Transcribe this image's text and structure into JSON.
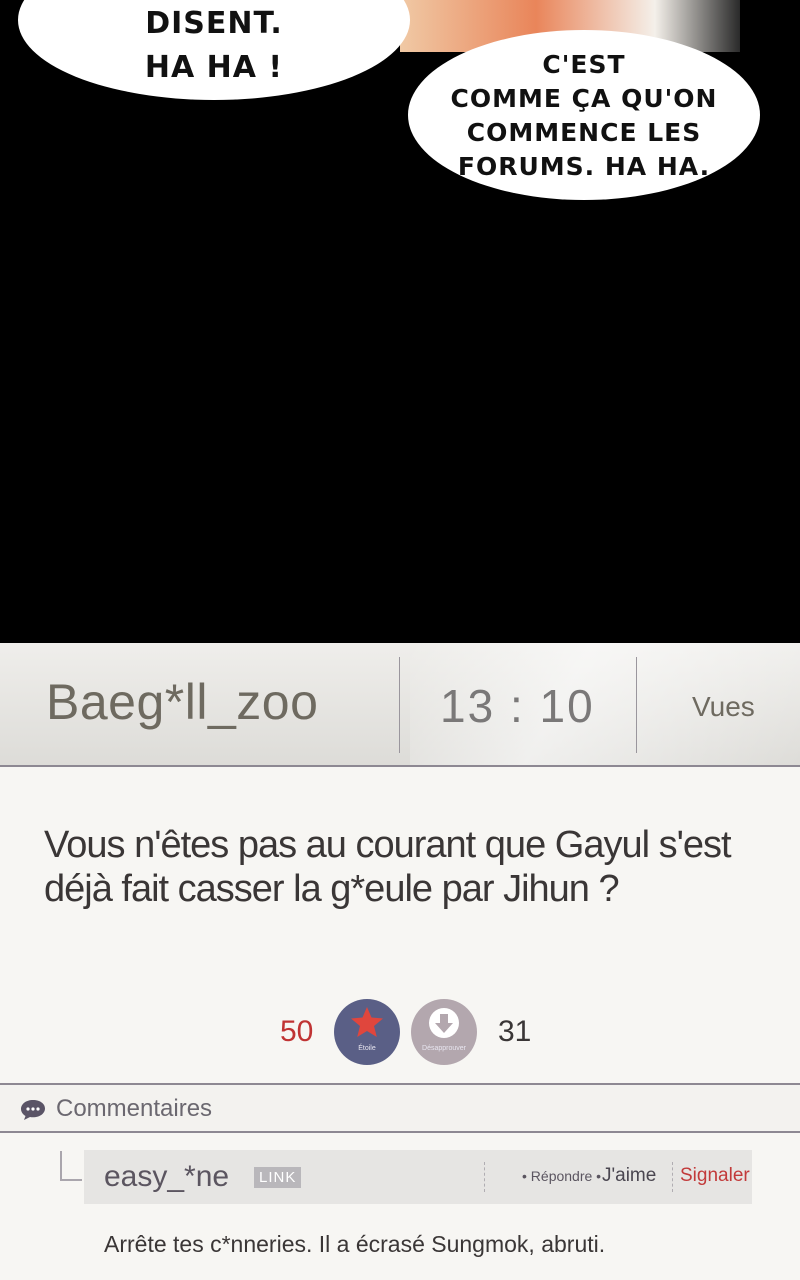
{
  "comic": {
    "bubble1_lines": [
      "DISENT.",
      "HA HA !"
    ],
    "bubble2_lines": [
      "C'EST",
      "COMME ÇA QU'ON",
      "COMMENCE LES",
      "FORUMS. HA HA."
    ]
  },
  "post": {
    "author": "Baeg*ll_zoo",
    "time": "13 : 10",
    "views_label": "Vues",
    "body": "Vous n'êtes pas au courant que Gayul s'est déjà fait casser la g*eule par Jihun ?",
    "star_count": "50",
    "star_label": "Étoile",
    "dislike_label": "Désapprouver",
    "dislike_count": "31"
  },
  "comments": {
    "title": "Commentaires",
    "items": [
      {
        "author": "easy_*ne",
        "badge": "LINK",
        "reply_label": "• Répondre •",
        "like_label": "J'aime",
        "report_label": "Signaler",
        "text": "Arrête tes c*nneries. Il a écrasé Sungmok, abruti."
      }
    ]
  },
  "colors": {
    "star_button": "#5a5f86",
    "dislike_button": "#b3a7ae",
    "star_count": "#c03333",
    "report": "#c23a3a"
  }
}
